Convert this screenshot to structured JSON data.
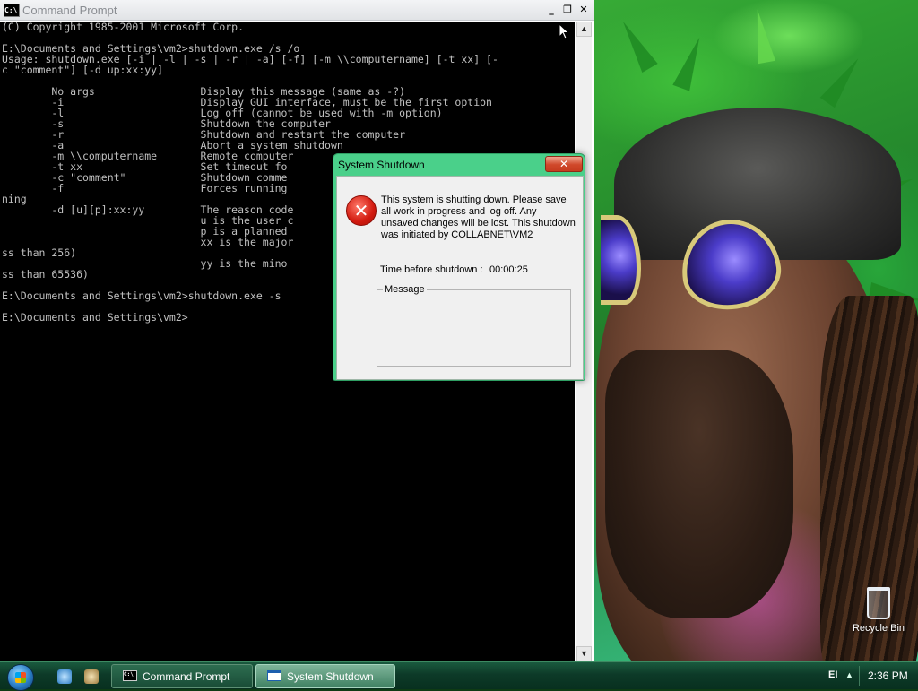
{
  "cmd": {
    "title": "Command Prompt",
    "icon": "cmd-icon",
    "lines": [
      "(C) Copyright 1985-2001 Microsoft Corp.",
      "",
      "E:\\Documents and Settings\\vm2>shutdown.exe /s /o",
      "Usage: shutdown.exe [-i | -l | -s | -r | -a] [-f] [-m \\\\computername] [-t xx] [-",
      "c \"comment\"] [-d up:xx:yy]",
      "",
      "        No args                 Display this message (same as -?)",
      "        -i                      Display GUI interface, must be the first option",
      "        -l                      Log off (cannot be used with -m option)",
      "        -s                      Shutdown the computer",
      "        -r                      Shutdown and restart the computer",
      "        -a                      Abort a system shutdown",
      "        -m \\\\computername       Remote computer",
      "        -t xx                   Set timeout fo",
      "        -c \"comment\"            Shutdown comme",
      "        -f                      Forces running",
      "ning",
      "        -d [u][p]:xx:yy         The reason code",
      "                                u is the user c",
      "                                p is a planned",
      "                                xx is the major",
      "ss than 256)",
      "                                yy is the mino",
      "ss than 65536)",
      "",
      "E:\\Documents and Settings\\vm2>shutdown.exe -s",
      "",
      "E:\\Documents and Settings\\vm2>"
    ],
    "buttons": {
      "minimize": "_",
      "maximize": "❐",
      "close": "✕"
    },
    "scroll_up": "▲",
    "scroll_down": "▼"
  },
  "dialog": {
    "title": "System Shutdown",
    "close": "✕",
    "icon": "error-icon",
    "icon_glyph": "✕",
    "message": "This system is shutting down. Please save all work in progress and log off. Any unsaved changes will be lost. This shutdown was initiated by COLLABNET\\VM2",
    "time_label": "Time before shutdown :",
    "time_value": "00:00:25",
    "message_group_label": "Message"
  },
  "desktop": {
    "recycle_bin_label": "Recycle Bin"
  },
  "taskbar": {
    "items": [
      {
        "label": "Command Prompt",
        "icon": "cmd-icon",
        "active": false
      },
      {
        "label": "System Shutdown",
        "icon": "window-icon",
        "active": true
      }
    ],
    "language": "EI",
    "tray_arrow": "▲",
    "clock": "2:36 PM"
  }
}
